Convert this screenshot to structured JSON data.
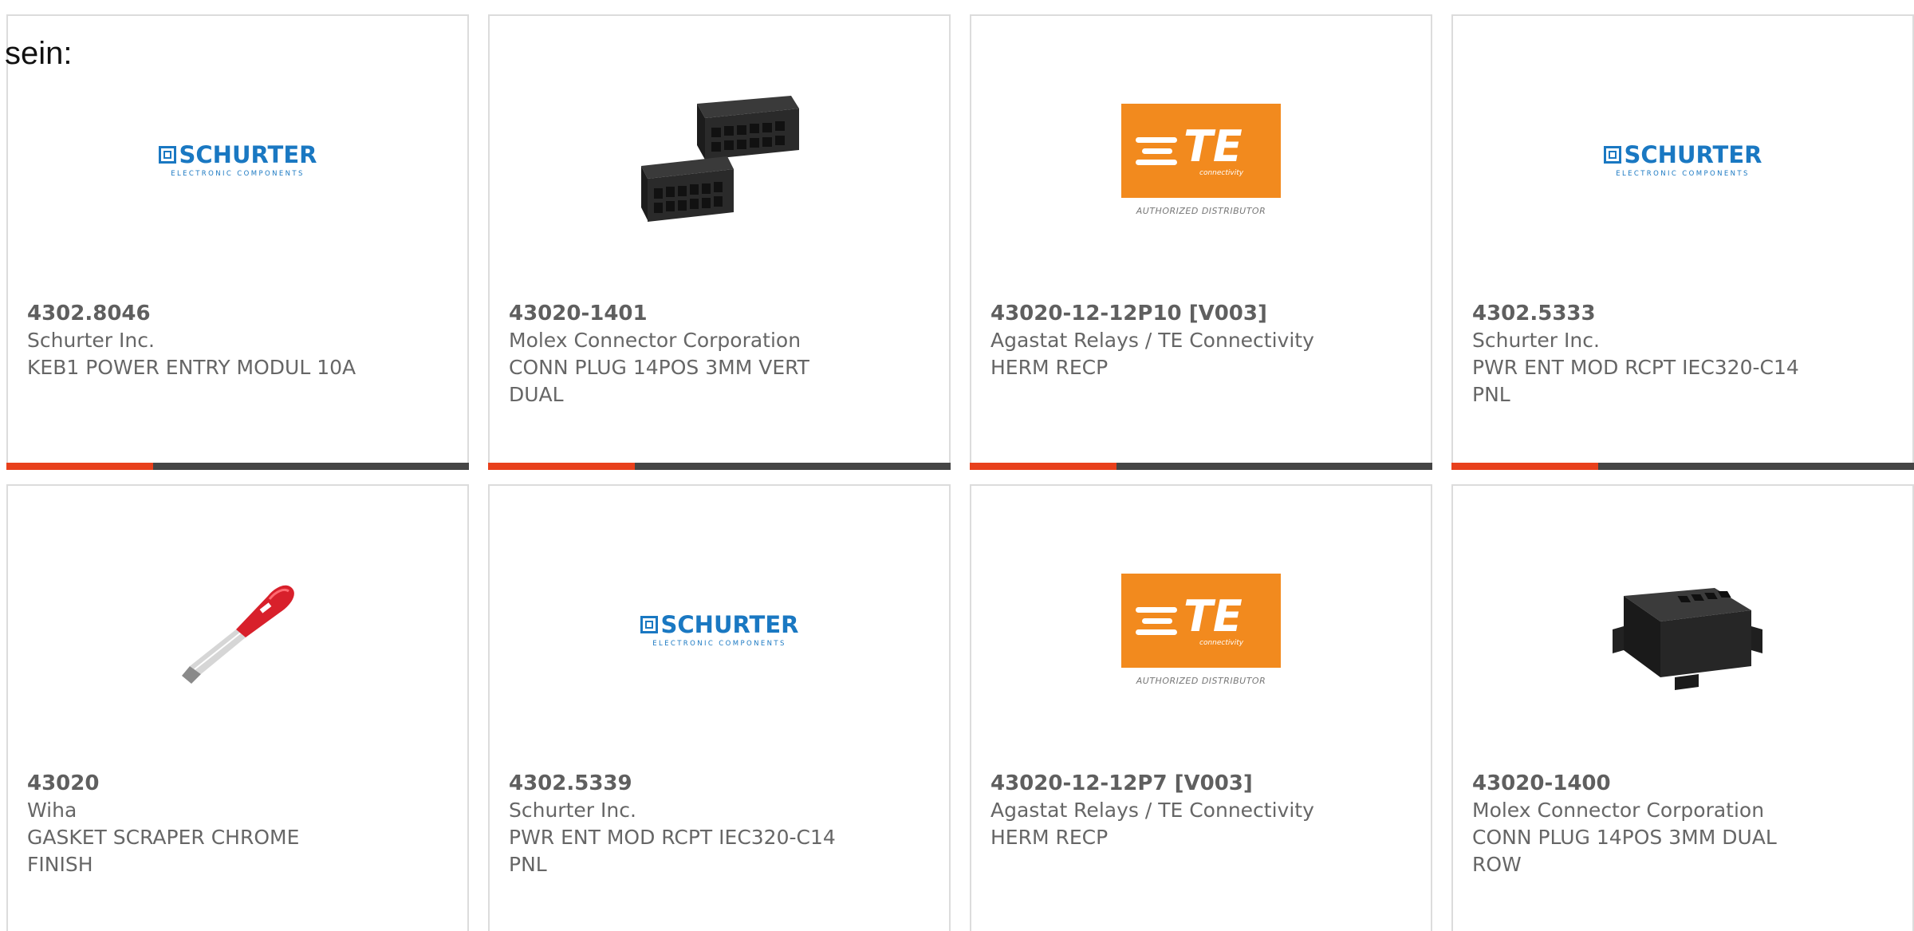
{
  "prefix_text": "sein:",
  "accent_color": "#e8401c",
  "bar_color": "#454545",
  "cards": [
    {
      "part_number": "4302.8046",
      "manufacturer": "Schurter Inc.",
      "description_lines": [
        "KEB1 POWER ENTRY MODUL 10A"
      ],
      "image": "schurter-logo",
      "logo_text": "SCHURTER",
      "logo_subtext": "ELECTRONIC COMPONENTS"
    },
    {
      "part_number": "43020-1401",
      "manufacturer": "Molex Connector Corporation",
      "description_lines": [
        "CONN PLUG 14POS 3MM VERT",
        "DUAL"
      ],
      "image": "connector-photo"
    },
    {
      "part_number": "43020-12-12P10 [V003]",
      "manufacturer": "Agastat Relays / TE Connectivity",
      "description_lines": [
        "HERM RECP"
      ],
      "image": "te-logo",
      "logo_text": "TE",
      "logo_small": "connectivity",
      "logo_subtext": "AUTHORIZED DISTRIBUTOR"
    },
    {
      "part_number": "4302.5333",
      "manufacturer": "Schurter Inc.",
      "description_lines": [
        "PWR ENT MOD RCPT IEC320-C14",
        "PNL"
      ],
      "image": "schurter-logo",
      "logo_text": "SCHURTER",
      "logo_subtext": "ELECTRONIC COMPONENTS"
    },
    {
      "part_number": "43020",
      "manufacturer": "Wiha",
      "description_lines": [
        "GASKET SCRAPER CHROME",
        "FINISH"
      ],
      "image": "scraper-photo"
    },
    {
      "part_number": "4302.5339",
      "manufacturer": "Schurter Inc.",
      "description_lines": [
        "PWR ENT MOD RCPT IEC320-C14",
        "PNL"
      ],
      "image": "schurter-logo",
      "logo_text": "SCHURTER",
      "logo_subtext": "ELECTRONIC COMPONENTS"
    },
    {
      "part_number": "43020-12-12P7 [V003]",
      "manufacturer": "Agastat Relays / TE Connectivity",
      "description_lines": [
        "HERM RECP"
      ],
      "image": "te-logo",
      "logo_text": "TE",
      "logo_small": "connectivity",
      "logo_subtext": "AUTHORIZED DISTRIBUTOR"
    },
    {
      "part_number": "43020-1400",
      "manufacturer": "Molex Connector Corporation",
      "description_lines": [
        "CONN PLUG 14POS 3MM DUAL",
        "ROW"
      ],
      "image": "connector-photo"
    }
  ]
}
